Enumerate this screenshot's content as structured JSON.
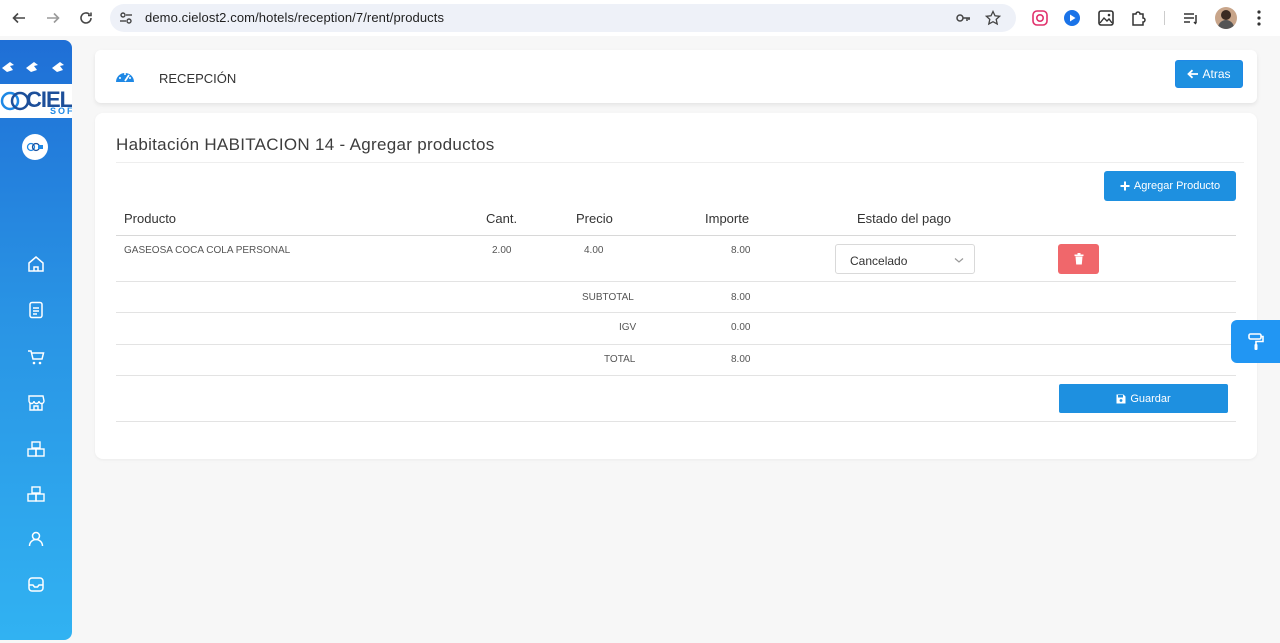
{
  "browser": {
    "url": "demo.cielost2.com/hotels/reception/7/rent/products"
  },
  "sidebar": {
    "brand": "CIEL",
    "brand_sub": "SOFT",
    "items": [
      {
        "icon": "home-icon"
      },
      {
        "icon": "document-icon"
      },
      {
        "icon": "cart-icon"
      },
      {
        "icon": "store-icon"
      },
      {
        "icon": "boxes-icon"
      },
      {
        "icon": "boxes-icon"
      },
      {
        "icon": "user-icon"
      },
      {
        "icon": "inbox-icon"
      }
    ]
  },
  "header": {
    "title": "RECEPCIÓN",
    "back_label": "Atras"
  },
  "main": {
    "title": "Habitación HABITACION 14 - Agregar productos",
    "add_label": "Agregar Producto",
    "columns": [
      "Producto",
      "Cant.",
      "Precio",
      "Importe",
      "Estado del pago"
    ],
    "rows": [
      {
        "producto": "GASEOSA COCA COLA PERSONAL",
        "cant": "2.00",
        "precio": "4.00",
        "importe": "8.00",
        "estado": "Cancelado"
      }
    ],
    "totals": [
      {
        "label": "SUBTOTAL",
        "value": "8.00"
      },
      {
        "label": "IGV",
        "value": "0.00"
      },
      {
        "label": "TOTAL",
        "value": "8.00"
      }
    ],
    "save_label": "Guardar"
  },
  "colors": {
    "primary": "#1e90e0",
    "danger": "#f0676b",
    "sidebar_top": "#1f6fd6",
    "sidebar_bottom": "#31b2f2"
  }
}
